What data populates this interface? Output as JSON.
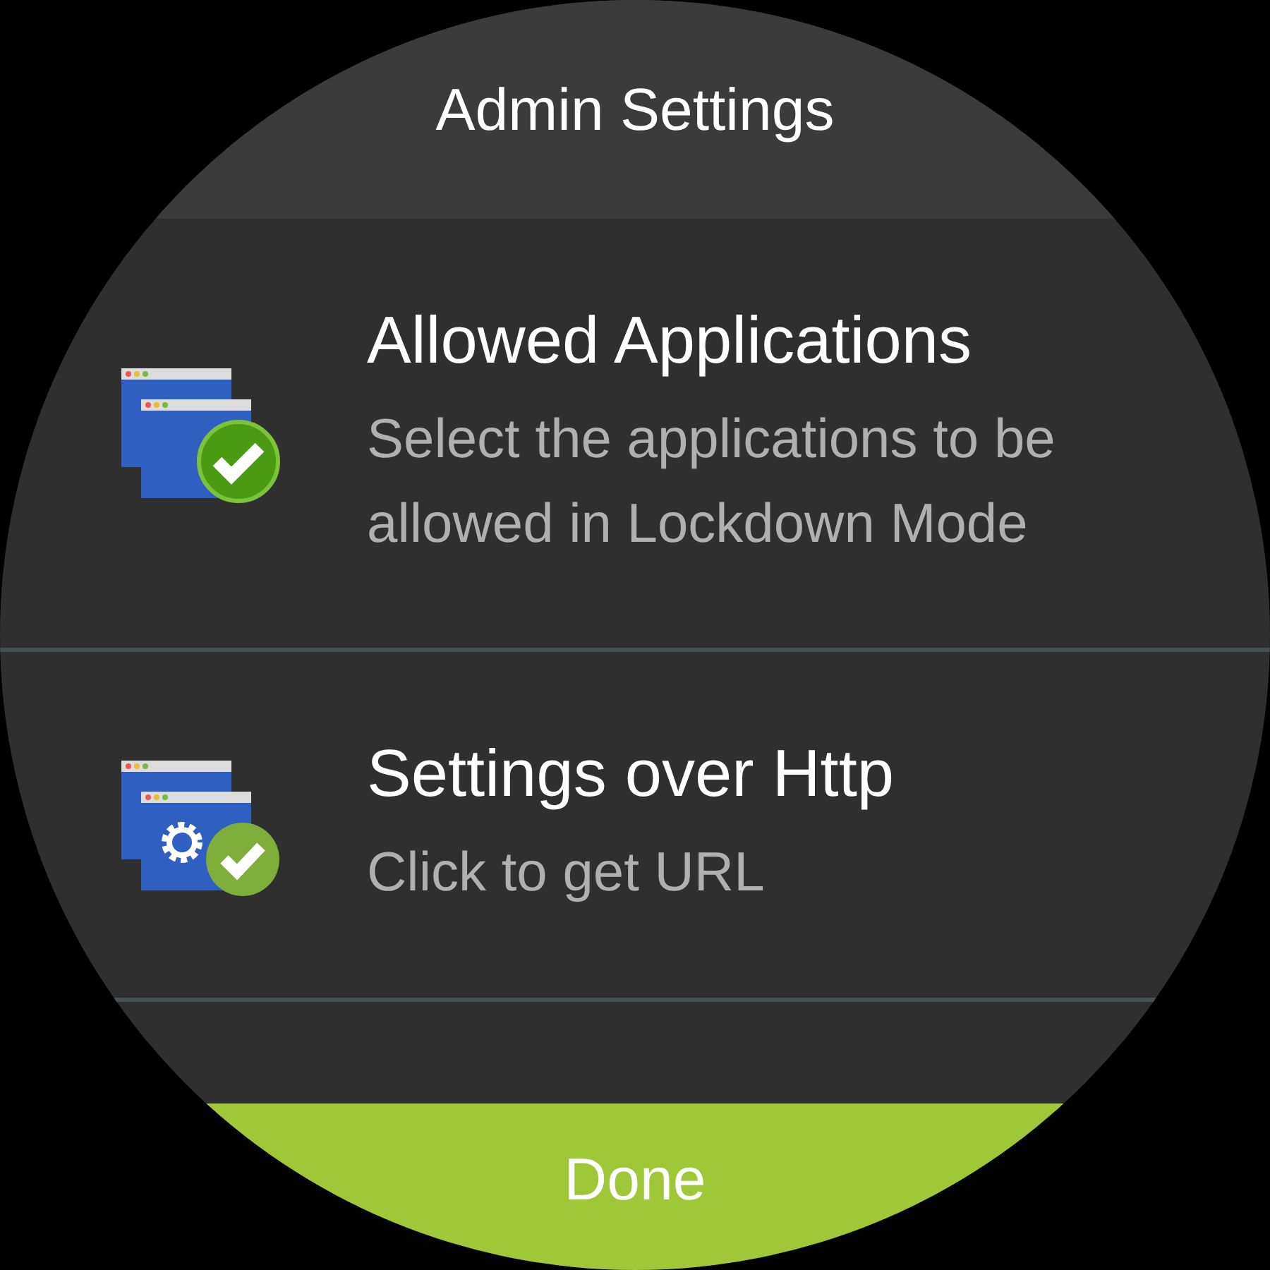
{
  "header": {
    "title": "Admin Settings"
  },
  "items": [
    {
      "kind": "apps",
      "title": "Allowed Applications",
      "subtitle": "Select the applications to be allowed in Lockdown Mode"
    },
    {
      "kind": "gear",
      "title": "Settings over Http",
      "subtitle": "Click to get URL"
    }
  ],
  "done_button": {
    "label": "Done"
  }
}
